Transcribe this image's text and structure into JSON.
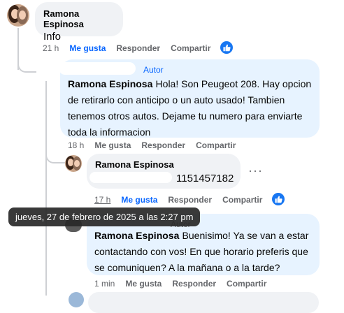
{
  "colors": {
    "like_blue": "#0866ff",
    "bubble_grey": "#f0f2f5",
    "bubble_blue": "#e7f3ff",
    "meta_grey": "#65676b"
  },
  "comments": [
    {
      "author": "Ramona Espinosa",
      "text": "Info",
      "time": "21 h",
      "like_label": "Me gusta",
      "reply_label": "Responder",
      "share_label": "Compartir",
      "reaction": "like-icon"
    },
    {
      "badge": "Autor",
      "author": "Ramona Espinosa",
      "text": "Hola! Son Peugeot 208. Hay opcion de retirarlo con anticipo o un auto usado! Tambien tenemos otros autos. Dejame tu numero para enviarte toda la informacion",
      "time": "18 h",
      "like_label": "Me gusta",
      "reply_label": "Responder",
      "share_label": "Compartir"
    },
    {
      "author": "Ramona Espinosa",
      "text": "1151457182",
      "time": "17 h",
      "like_label": "Me gusta",
      "reply_label": "Responder",
      "share_label": "Compartir",
      "reaction": "like-icon",
      "more_icon": "more-icon"
    },
    {
      "badge": "Autor",
      "author": "Ramona Espinosa",
      "text": "Buenisimo! Ya se van a estar contactando con vos! En que horario preferis que se comuniquen? A la mañana o a la tarde?",
      "time": "1 min",
      "like_label": "Me gusta",
      "reply_label": "Responder",
      "share_label": "Compartir"
    }
  ],
  "tooltip": "jueves, 27 de febrero de 2025 a las 2:27 pm"
}
